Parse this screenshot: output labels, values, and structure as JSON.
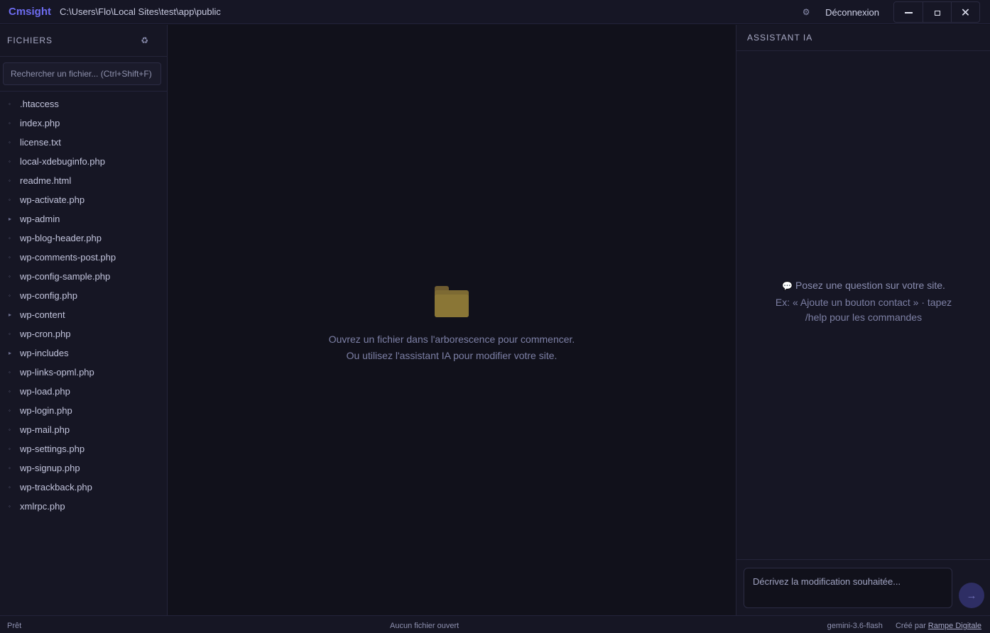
{
  "titlebar": {
    "brand": "Cmsight",
    "path": "C:\\Users\\Flo\\Local Sites\\test\\app\\public",
    "settings_icon": "gear-icon",
    "logout_label": "Déconnexion"
  },
  "sidebar": {
    "title": "FICHIERS",
    "refresh_icon": "recycle-icon",
    "search_placeholder": "Rechercher un fichier... (Ctrl+Shift+F)",
    "files": [
      {
        "name": ".htaccess",
        "type": "file",
        "marker": "◦"
      },
      {
        "name": "index.php",
        "type": "file",
        "marker": "◦"
      },
      {
        "name": "license.txt",
        "type": "file",
        "marker": "◦"
      },
      {
        "name": "local-xdebuginfo.php",
        "type": "file",
        "marker": "◦"
      },
      {
        "name": "readme.html",
        "type": "file",
        "marker": "◦"
      },
      {
        "name": "wp-activate.php",
        "type": "file",
        "marker": "◦"
      },
      {
        "name": "wp-admin",
        "type": "folder",
        "marker": "▸"
      },
      {
        "name": "wp-blog-header.php",
        "type": "file",
        "marker": "◦"
      },
      {
        "name": "wp-comments-post.php",
        "type": "file",
        "marker": "◦"
      },
      {
        "name": "wp-config-sample.php",
        "type": "file",
        "marker": "◦"
      },
      {
        "name": "wp-config.php",
        "type": "file",
        "marker": "◦"
      },
      {
        "name": "wp-content",
        "type": "folder",
        "marker": "▸"
      },
      {
        "name": "wp-cron.php",
        "type": "file",
        "marker": "◦"
      },
      {
        "name": "wp-includes",
        "type": "folder",
        "marker": "▸"
      },
      {
        "name": "wp-links-opml.php",
        "type": "file",
        "marker": "◦"
      },
      {
        "name": "wp-load.php",
        "type": "file",
        "marker": "◦"
      },
      {
        "name": "wp-login.php",
        "type": "file",
        "marker": "◦"
      },
      {
        "name": "wp-mail.php",
        "type": "file",
        "marker": "◦"
      },
      {
        "name": "wp-settings.php",
        "type": "file",
        "marker": "◦"
      },
      {
        "name": "wp-signup.php",
        "type": "file",
        "marker": "◦"
      },
      {
        "name": "wp-trackback.php",
        "type": "file",
        "marker": "◦"
      },
      {
        "name": "xmlrpc.php",
        "type": "file",
        "marker": "◦"
      }
    ]
  },
  "editor": {
    "empty_icon": "folder-icon",
    "line1": "Ouvrez un fichier dans l'arborescence pour commencer.",
    "line2": "Ou utilisez l'assistant IA pour modifier votre site."
  },
  "assistant": {
    "title": "ASSISTANT IA",
    "hint_icon": "speech-bubble-icon",
    "hint_question": "Posez une question sur votre site.",
    "hint_example": "Ex: « Ajoute un bouton contact » · tapez /help pour les commandes",
    "input_placeholder": "Décrivez la modification souhaitée...",
    "send_label": "→"
  },
  "statusbar": {
    "left": "Prêt",
    "center": "Aucun fichier ouvert",
    "model": "gemini-3.6-flash",
    "credit_prefix": "Créé par",
    "credit_link": "Rampe Digitale"
  },
  "colors": {
    "accent": "#6d6cf0",
    "background": "#11111b",
    "panel": "#161624"
  }
}
